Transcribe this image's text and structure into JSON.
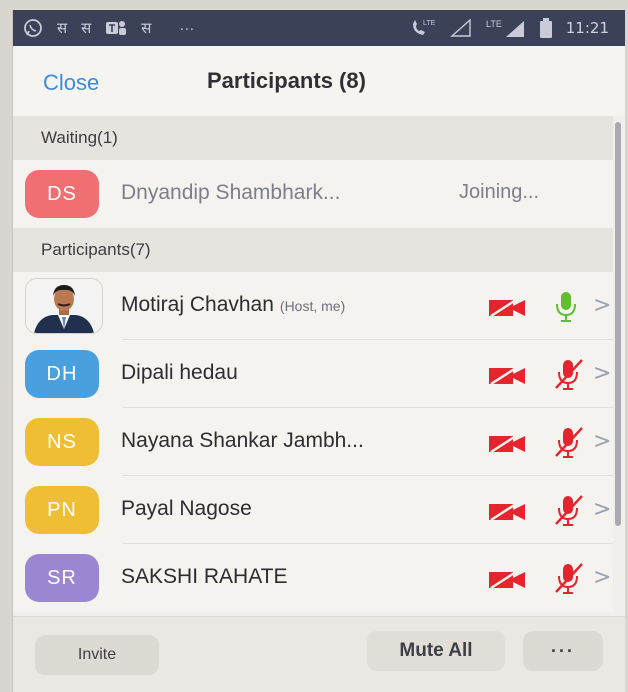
{
  "status_bar": {
    "icons": [
      "whatsapp-icon",
      "hindi-s-icon",
      "hindi-s-icon",
      "teams-icon",
      "hindi-s-icon",
      "overflow-icon",
      "volte-call-icon",
      "lte-signal-icon",
      "lte-signal-icon",
      "battery-icon"
    ],
    "glyph": "स",
    "overflow": "···",
    "lte": "LTE",
    "time": "11:21"
  },
  "header": {
    "close_label": "Close",
    "title": "Participants (8)",
    "accent_color": "#3a8cd8"
  },
  "waiting": {
    "label": "Waiting(1)",
    "items": [
      {
        "initials": "DS",
        "name": "Dnyandip Shambhark...",
        "status": "Joining...",
        "avatar_color": "#ef6f73"
      }
    ]
  },
  "participants": {
    "label": "Participants(7)",
    "items": [
      {
        "name": "Motiraj Chavhan",
        "tag": "(Host, me)",
        "avatar": "photo",
        "video": "off",
        "audio": "on"
      },
      {
        "initials": "DH",
        "name": "Dipali hedau",
        "avatar_color": "#4aa0de",
        "video": "off",
        "audio": "muted"
      },
      {
        "initials": "NS",
        "name": "Nayana Shankar Jambh...",
        "avatar_color": "#f0be35",
        "video": "off",
        "audio": "muted"
      },
      {
        "initials": "PN",
        "name": "Payal Nagose",
        "avatar_color": "#f0be35",
        "video": "off",
        "audio": "muted"
      },
      {
        "initials": "SR",
        "name": "SAKSHI RAHATE",
        "avatar_color": "#9a86d2",
        "video": "off",
        "audio": "muted"
      }
    ]
  },
  "footer": {
    "invite_label": "Invite",
    "mute_all_label": "Mute All",
    "more_label": "···"
  },
  "colors": {
    "video_off": "#e4252e",
    "mic_on": "#5fbf2e",
    "mic_muted": "#e4252e"
  }
}
